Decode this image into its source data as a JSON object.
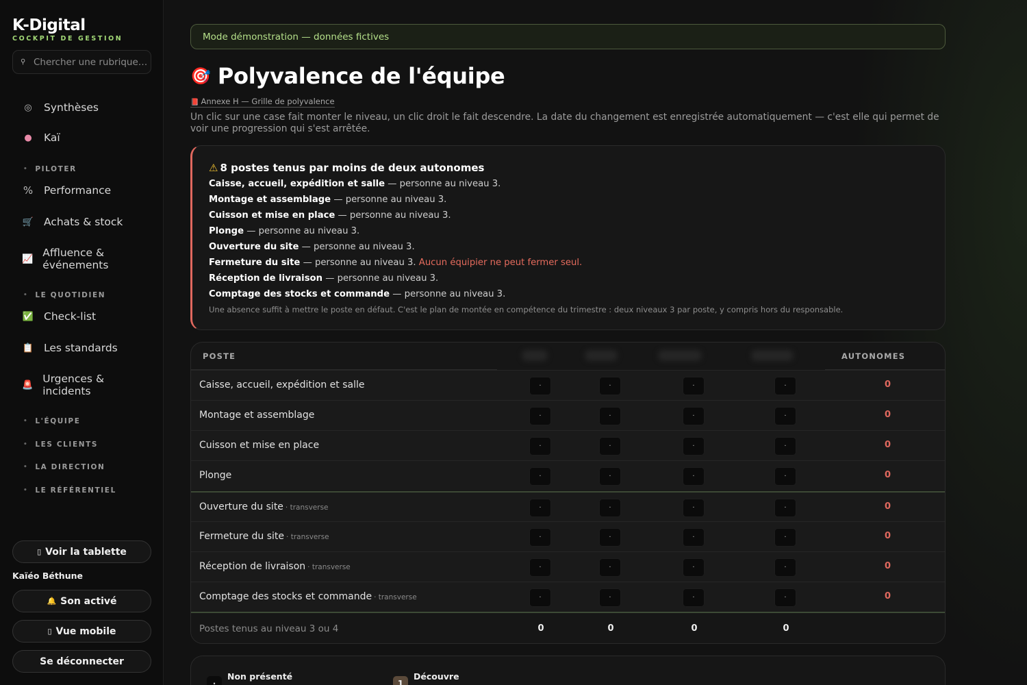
{
  "brand": {
    "name": "K-Digital",
    "subtitle": "COCKPIT DE GESTION"
  },
  "sidebar": {
    "search_placeholder": "Chercher une rubrique…",
    "items": [
      {
        "label": "Synthèses",
        "icon": "target-icon"
      },
      {
        "label": "Kaï",
        "icon": "brain-icon"
      },
      {
        "label": "Performance",
        "icon": "percent-icon"
      },
      {
        "label": "Achats & stock",
        "icon": "cart-icon"
      },
      {
        "label": "Affluence & événements",
        "icon": "chart-icon"
      },
      {
        "label": "Check-list",
        "icon": "checkbox-icon"
      },
      {
        "label": "Les standards",
        "icon": "clipboard-icon"
      },
      {
        "label": "Urgences & incidents",
        "icon": "siren-icon"
      }
    ],
    "sections": [
      "PILOTER",
      "LE QUOTIDIEN",
      "L'ÉQUIPE",
      "LES CLIENTS",
      "LA DIRECTION",
      "LE RÉFÉRENTIEL"
    ],
    "tablet_button": "Voir la tablette",
    "user_name": "Kaïéo Béthune",
    "sound_button": "Son activé",
    "mobile_button": "Vue mobile",
    "logout_button": "Se déconnecter"
  },
  "demo_banner": "Mode démonstration — données fictives",
  "page": {
    "title": "Polyvalence de l'équipe",
    "annex": "Annexe H — Grille de polyvalence",
    "intro": "Un clic sur une case fait monter le niveau, un clic droit le fait descendre. La date du changement est enregistrée automatiquement — c'est elle qui permet de voir une progression qui s'est arrêtée."
  },
  "alert": {
    "title": "8 postes tenus par moins de deux autonomes",
    "lines": [
      {
        "post": "Caisse, accueil, expédition et salle",
        "text": " — personne au niveau 3.",
        "extra": ""
      },
      {
        "post": "Montage et assemblage",
        "text": " — personne au niveau 3.",
        "extra": ""
      },
      {
        "post": "Cuisson et mise en place",
        "text": " — personne au niveau 3.",
        "extra": ""
      },
      {
        "post": "Plonge",
        "text": " — personne au niveau 3.",
        "extra": ""
      },
      {
        "post": "Ouverture du site",
        "text": " — personne au niveau 3.",
        "extra": ""
      },
      {
        "post": "Fermeture du site",
        "text": " — personne au niveau 3. ",
        "extra": "Aucun équipier ne peut fermer seul."
      },
      {
        "post": "Réception de livraison",
        "text": " — personne au niveau 3.",
        "extra": ""
      },
      {
        "post": "Comptage des stocks et commande",
        "text": " — personne au niveau 3.",
        "extra": ""
      }
    ],
    "footnote": "Une absence suffit à mettre le poste en défaut. C'est le plan de montée en compétence du trimestre : deux niveaux 3 par poste, y compris hors du responsable."
  },
  "table": {
    "col_poste": "POSTE",
    "col_autonomes": "AUTONOMES",
    "rows": [
      {
        "label": "Caisse, accueil, expédition et salle",
        "tag": "",
        "cells": [
          "·",
          "·",
          "·",
          "·"
        ],
        "autonomes": "0"
      },
      {
        "label": "Montage et assemblage",
        "tag": "",
        "cells": [
          "·",
          "·",
          "·",
          "·"
        ],
        "autonomes": "0"
      },
      {
        "label": "Cuisson et mise en place",
        "tag": "",
        "cells": [
          "·",
          "·",
          "·",
          "·"
        ],
        "autonomes": "0"
      },
      {
        "label": "Plonge",
        "tag": "",
        "cells": [
          "·",
          "·",
          "·",
          "·"
        ],
        "autonomes": "0"
      },
      {
        "label": "Ouverture du site",
        "tag": "· transverse",
        "cells": [
          "·",
          "·",
          "·",
          "·"
        ],
        "autonomes": "0"
      },
      {
        "label": "Fermeture du site",
        "tag": "· transverse",
        "cells": [
          "·",
          "·",
          "·",
          "·"
        ],
        "autonomes": "0"
      },
      {
        "label": "Réception de livraison",
        "tag": "· transverse",
        "cells": [
          "·",
          "·",
          "·",
          "·"
        ],
        "autonomes": "0"
      },
      {
        "label": "Comptage des stocks et commande",
        "tag": "· transverse",
        "cells": [
          "·",
          "·",
          "·",
          "·"
        ],
        "autonomes": "0"
      }
    ],
    "footer_label": "Postes tenus au niveau 3 ou 4",
    "footer_values": [
      "0",
      "0",
      "0",
      "0"
    ]
  },
  "legend": [
    {
      "badge": "·",
      "title": "Non présenté"
    },
    {
      "badge": "1",
      "title": "Découvre"
    }
  ],
  "colors": {
    "accent_green": "#a3d977",
    "alert_red": "#e0685e"
  }
}
